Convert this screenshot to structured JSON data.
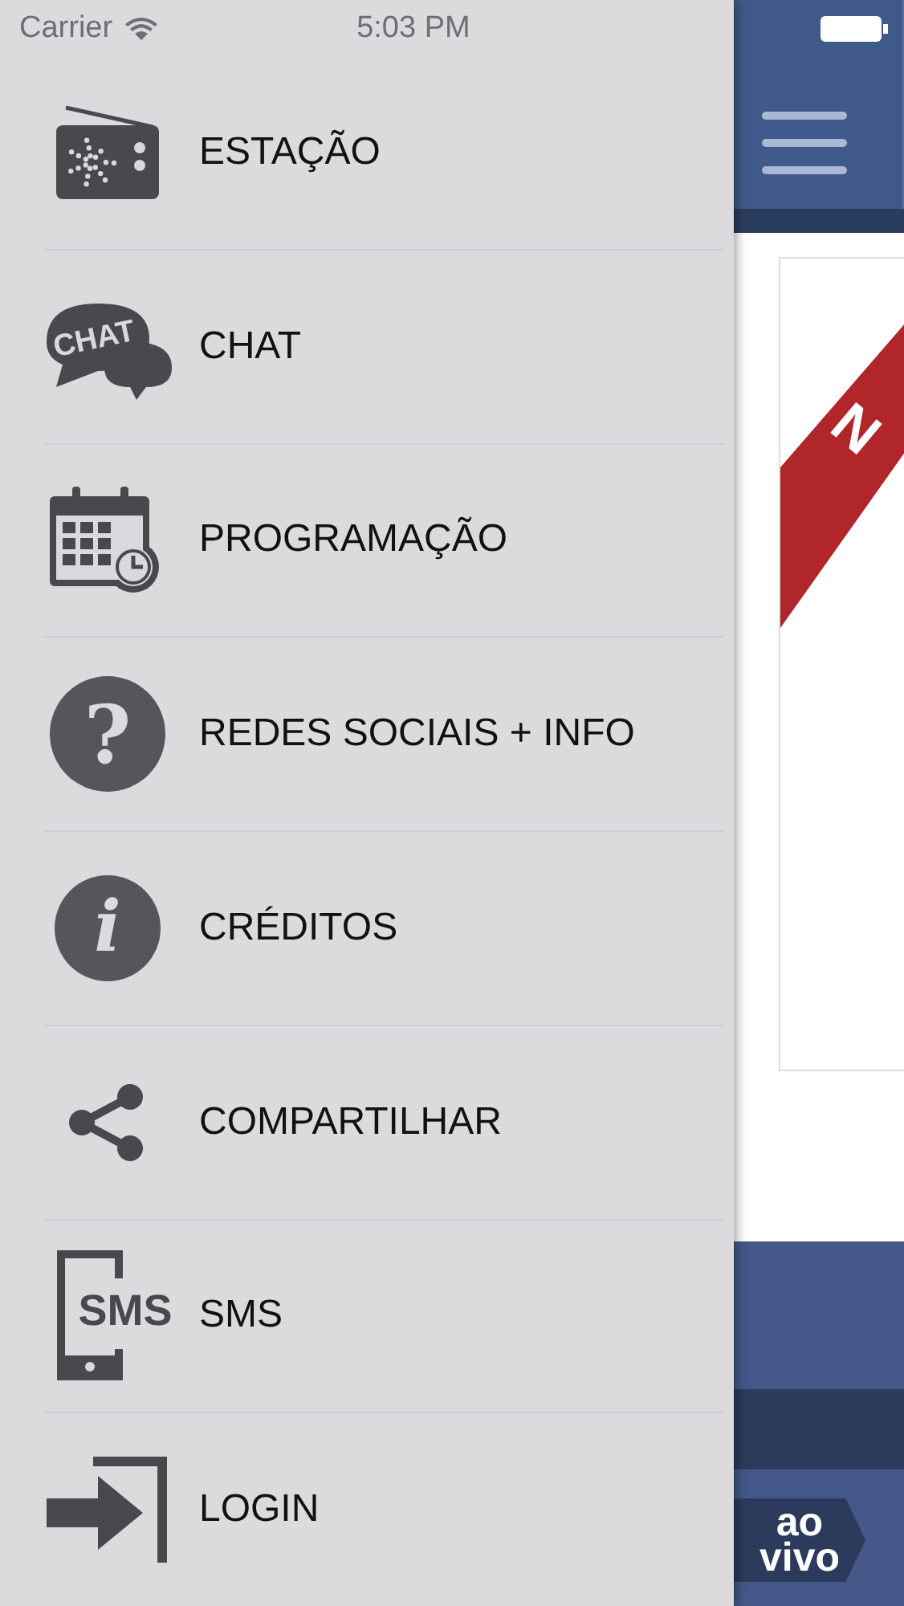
{
  "status_bar": {
    "carrier": "Carrier",
    "time": "5:03 PM"
  },
  "menu": [
    {
      "kind": "radio",
      "label": "ESTAÇÃO"
    },
    {
      "kind": "chat",
      "label": "CHAT",
      "icon_text": "CHAT"
    },
    {
      "kind": "calendar",
      "label": "PROGRAMAÇÃO"
    },
    {
      "kind": "help",
      "label": "REDES SOCIAIS + INFO",
      "icon_text": "?"
    },
    {
      "kind": "info",
      "label": "CRÉDITOS",
      "icon_text": "i"
    },
    {
      "kind": "share",
      "label": "COMPARTILHAR"
    },
    {
      "kind": "sms",
      "label": "SMS",
      "icon_text": "SMS"
    },
    {
      "kind": "login",
      "label": "LOGIN"
    }
  ],
  "content": {
    "banner_text": "N",
    "live_badge": [
      "ao",
      "vivo"
    ]
  }
}
